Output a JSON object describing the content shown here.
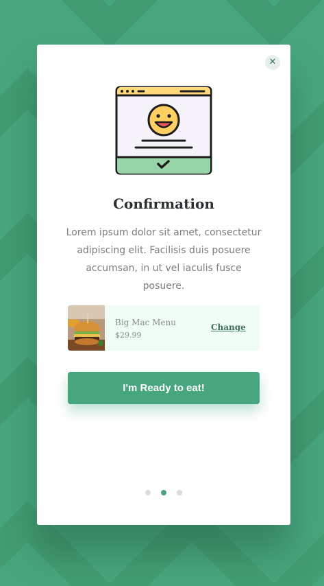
{
  "modal": {
    "title": "Confirmation",
    "description": "Lorem ipsum dolor sit amet, consectetur adipiscing elit. Facilisis duis posuere accumsan, in ut vel iaculis fusce posuere.",
    "close_label": "✕"
  },
  "product": {
    "name": "Big Mac Menu",
    "price": "$29.99",
    "change_label": "Change",
    "image_icon": "burger-photo"
  },
  "cta": {
    "label": "I'm Ready to eat!"
  },
  "pagination": {
    "count": 3,
    "active_index": 1
  },
  "colors": {
    "background": "#48a67e",
    "accent": "#48a67e",
    "card": "#ffffff",
    "product_bg": "#f0fdf5",
    "window_header": "#ffd97a",
    "window_footer": "#97d5a8",
    "smiley": "#ffd061"
  }
}
